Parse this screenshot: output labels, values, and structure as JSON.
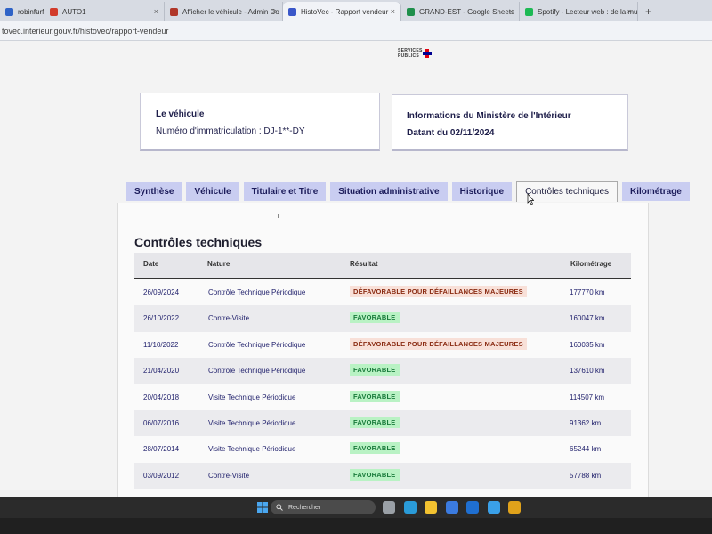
{
  "browser": {
    "tabs": [
      {
        "label": "robinfurfo",
        "favicon_color": "#2f63c7",
        "width": 50
      },
      {
        "label": "AUTO1",
        "favicon_color": "#d23b2b",
        "width": 135
      },
      {
        "label": "Afficher le véhicule - Admin Co",
        "favicon_color": "#b0372a",
        "width": 133
      },
      {
        "label": "HistoVec - Rapport vendeur",
        "favicon_color": "#3a57c9",
        "width": 133,
        "active": true
      },
      {
        "label": "GRAND-EST - Google Sheets",
        "favicon_color": "#1f8f4b",
        "width": 133
      },
      {
        "label": "Spotify - Lecteur web : de la mu",
        "favicon_color": "#1db954",
        "width": 133
      }
    ],
    "url": "tovec.interieur.gouv.fr/histovec/rapport-vendeur"
  },
  "logo": {
    "line1": "SERVICES",
    "line2": "PUBLICS"
  },
  "vehicle_card": {
    "title": "Le véhicule",
    "registration": "Numéro d'immatriculation : DJ-1**-DY"
  },
  "ministere_card": {
    "title": "Informations du Ministère de l'Intérieur",
    "date": "Datant du 02/11/2024"
  },
  "tabs": [
    {
      "label": "Synthèse"
    },
    {
      "label": "Véhicule"
    },
    {
      "label": "Titulaire et Titre"
    },
    {
      "label": "Situation administrative"
    },
    {
      "label": "Historique"
    },
    {
      "label": "Contrôles techniques",
      "active": true
    },
    {
      "label": "Kilométrage"
    }
  ],
  "section_title": "Contrôles techniques",
  "table": {
    "headers": {
      "date": "Date",
      "nature": "Nature",
      "result": "Résultat",
      "km": "Kilométrage"
    },
    "rows": [
      {
        "date": "26/09/2024",
        "nature": "Contrôle Technique Périodique",
        "result": "DÉFAVORABLE POUR DÉFAILLANCES MAJEURES",
        "status": "defav",
        "km": "177770 km"
      },
      {
        "date": "26/10/2022",
        "nature": "Contre-Visite",
        "result": "FAVORABLE",
        "status": "fav",
        "km": "160047 km"
      },
      {
        "date": "11/10/2022",
        "nature": "Contrôle Technique Périodique",
        "result": "DÉFAVORABLE POUR DÉFAILLANCES MAJEURES",
        "status": "defav",
        "km": "160035 km"
      },
      {
        "date": "21/04/2020",
        "nature": "Contrôle Technique Périodique",
        "result": "FAVORABLE",
        "status": "fav",
        "km": "137610 km"
      },
      {
        "date": "20/04/2018",
        "nature": "Visite Technique Périodique",
        "result": "FAVORABLE",
        "status": "fav",
        "km": "114507 km"
      },
      {
        "date": "06/07/2016",
        "nature": "Visite Technique Périodique",
        "result": "FAVORABLE",
        "status": "fav",
        "km": "91362 km"
      },
      {
        "date": "28/07/2014",
        "nature": "Visite Technique Périodique",
        "result": "FAVORABLE",
        "status": "fav",
        "km": "65244 km"
      },
      {
        "date": "03/09/2012",
        "nature": "Contre-Visite",
        "result": "FAVORABLE",
        "status": "fav",
        "km": "57788 km"
      }
    ]
  },
  "taskbar": {
    "search_placeholder": "Rechercher",
    "app_icons": [
      {
        "name": "task-view-icon",
        "color": "#9aa0a6"
      },
      {
        "name": "edge-icon",
        "color": "#2a9bd8"
      },
      {
        "name": "file-explorer-icon",
        "color": "#f2c230"
      },
      {
        "name": "store-icon",
        "color": "#3b7be0"
      },
      {
        "name": "outlook-icon",
        "color": "#1f6fd1"
      },
      {
        "name": "news-icon",
        "color": "#3aa0e8"
      },
      {
        "name": "chrome-icon",
        "color": "#e0a21b"
      }
    ]
  }
}
